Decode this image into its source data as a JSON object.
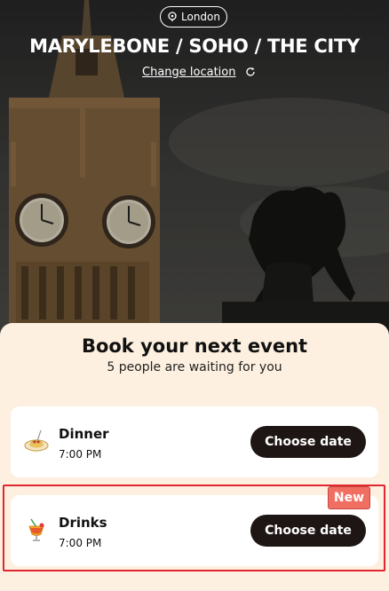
{
  "location": {
    "city": "London",
    "area_title": "MARYLEBONE / SOHO / THE CITY",
    "change_label": "Change location"
  },
  "booking": {
    "title": "Book your next event",
    "subtitle": "5 people are waiting for you"
  },
  "events": [
    {
      "name": "Dinner",
      "time": "7:00 PM",
      "button_label": "Choose date",
      "icon": "dinner-plate-icon"
    },
    {
      "name": "Drinks",
      "time": "7:00 PM",
      "button_label": "Choose date",
      "icon": "cocktail-icon",
      "badge": "New"
    }
  ],
  "colors": {
    "accent_dark": "#1e1614",
    "panel_bg": "#fdf0e0",
    "badge_bg": "#f06e62",
    "highlight": "#e0262e"
  }
}
